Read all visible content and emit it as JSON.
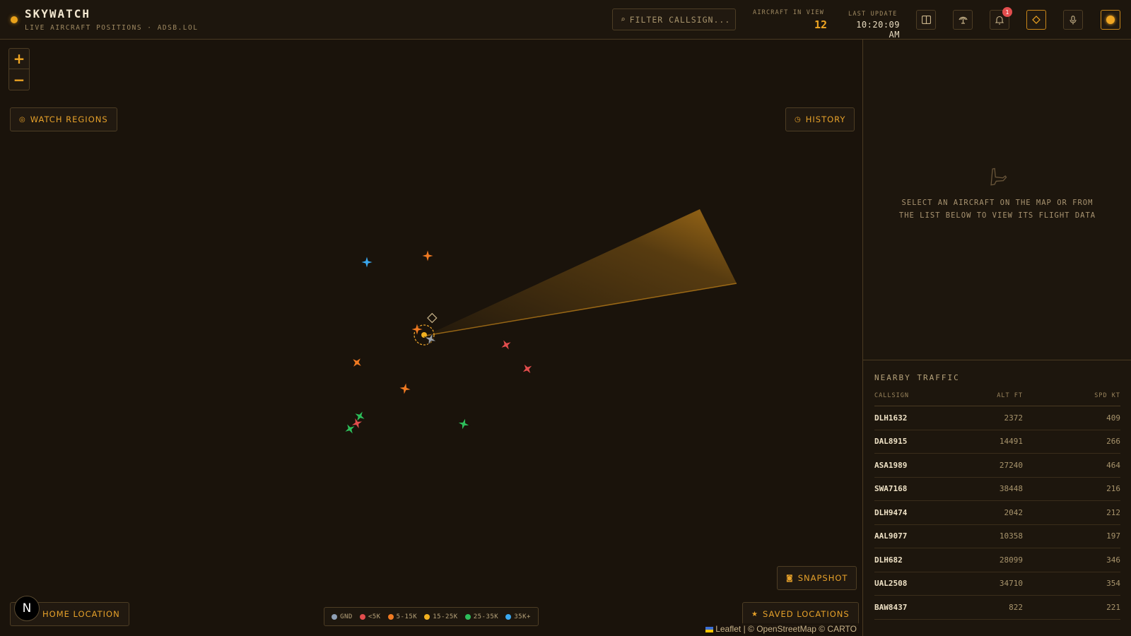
{
  "header": {
    "title": "SKYWATCH",
    "subtitle": "LIVE AIRCRAFT POSITIONS · ADSB.LOL",
    "filter_placeholder": "FILTER CALLSIGN...",
    "aircraft_in_view_label": "AIRCRAFT IN VIEW",
    "aircraft_in_view": "12",
    "last_update_label": "LAST UPDATE",
    "last_update": "10:20:09 AM",
    "notification_count": "1",
    "icons": [
      "split-view-icon",
      "radio-tower-icon",
      "bell-icon",
      "diamond-icon",
      "microphone-icon",
      "sun-icon"
    ]
  },
  "map": {
    "zoom_in": "+",
    "zoom_out": "−",
    "watch_regions": "WATCH REGIONS",
    "history": "HISTORY",
    "snapshot": "SNAPSHOT",
    "home_location": "HOME LOCATION",
    "saved_locations": "SAVED LOCATIONS",
    "attribution_leaflet": "Leaflet",
    "attribution_rest": " | © OpenStreetMap © CARTO",
    "logo_letter": "N",
    "legend": [
      {
        "label": "GND",
        "color": "#8fa0b5"
      },
      {
        "label": "<5K",
        "color": "#e24d4d"
      },
      {
        "label": "5-15K",
        "color": "#f07a22"
      },
      {
        "label": "15-25K",
        "color": "#f0b020"
      },
      {
        "label": "25-35K",
        "color": "#2dbd5a"
      },
      {
        "label": "35K+",
        "color": "#3aa8f0"
      }
    ],
    "aircraft_colors": [
      "#3aa8f0",
      "#f07a22",
      "#e24d4d",
      "#2dbd5a",
      "#9aa0a8"
    ]
  },
  "panel": {
    "placeholder": "SELECT AN AIRCRAFT ON THE MAP OR FROM THE LIST BELOW TO VIEW ITS FLIGHT DATA",
    "traffic_title": "NEARBY TRAFFIC",
    "columns": [
      "CALLSIGN",
      "ALT FT",
      "SPD KT"
    ],
    "rows": [
      {
        "callsign": "DLH1632",
        "alt": "2372",
        "spd": "409"
      },
      {
        "callsign": "DAL8915",
        "alt": "14491",
        "spd": "266"
      },
      {
        "callsign": "ASA1989",
        "alt": "27240",
        "spd": "464"
      },
      {
        "callsign": "SWA7168",
        "alt": "38448",
        "spd": "216"
      },
      {
        "callsign": "DLH9474",
        "alt": "2042",
        "spd": "212"
      },
      {
        "callsign": "AAL9077",
        "alt": "10358",
        "spd": "197"
      },
      {
        "callsign": "DLH682",
        "alt": "28099",
        "spd": "346"
      },
      {
        "callsign": "UAL2508",
        "alt": "34710",
        "spd": "354"
      },
      {
        "callsign": "BAW8437",
        "alt": "822",
        "spd": "221"
      }
    ]
  }
}
